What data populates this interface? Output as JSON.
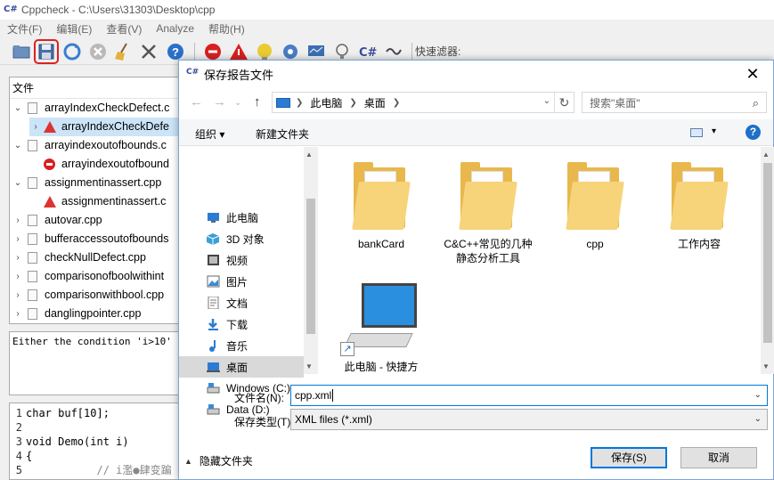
{
  "app": {
    "title": "Cppcheck - C:\\Users\\31303\\Desktop\\cpp",
    "menu": [
      "文件(F)",
      "编辑(E)",
      "查看(V)",
      "Analyze",
      "帮助(H)"
    ],
    "quick_filter_label": "快速滤器:"
  },
  "tree": {
    "header": "文件",
    "rows": [
      {
        "text": "arrayIndexCheckDefect.c",
        "level": 0,
        "expander": "v",
        "icon": "file-icon"
      },
      {
        "text": "arrayIndexCheckDefe",
        "level": 1,
        "expander": ">",
        "icon": "warning-icon",
        "selected": true
      },
      {
        "text": "arrayindexoutofbounds.c",
        "level": 0,
        "expander": "v",
        "icon": "file-icon"
      },
      {
        "text": "arrayindexoutofbound",
        "level": 1,
        "expander": "",
        "icon": "error-icon"
      },
      {
        "text": "assignmentinassert.cpp",
        "level": 0,
        "expander": "v",
        "icon": "file-icon"
      },
      {
        "text": "assignmentinassert.c",
        "level": 1,
        "expander": "",
        "icon": "warning-icon"
      },
      {
        "text": "autovar.cpp",
        "level": 0,
        "expander": ">",
        "icon": "file-icon"
      },
      {
        "text": "bufferaccessoutofbounds",
        "level": 0,
        "expander": ">",
        "icon": "file-icon"
      },
      {
        "text": "checkNullDefect.cpp",
        "level": 0,
        "expander": ">",
        "icon": "file-icon"
      },
      {
        "text": "comparisonofboolwithint",
        "level": 0,
        "expander": ">",
        "icon": "file-icon"
      },
      {
        "text": "comparisonwithbool.cpp",
        "level": 0,
        "expander": ">",
        "icon": "file-icon"
      },
      {
        "text": "danglingpointer.cpp",
        "level": 0,
        "expander": ">",
        "icon": "file-icon"
      }
    ]
  },
  "detail_text": "Either the condition 'i>10' is",
  "code": [
    {
      "n": "1",
      "text": "char buf[10];"
    },
    {
      "n": "2",
      "text": ""
    },
    {
      "n": "3",
      "text": "void Demo(int i)"
    },
    {
      "n": "4",
      "text": "{"
    },
    {
      "n": "5",
      "text": "           // i濫●肆变蹁"
    }
  ],
  "dialog": {
    "title": "保存报告文件",
    "close_glyph": "✕",
    "breadcrumb": [
      "此电脑",
      "桌面"
    ],
    "search_placeholder": "搜索\"桌面\"",
    "organize_label": "组织 ▾",
    "new_folder_label": "新建文件夹",
    "nav_items": [
      {
        "label": "此电脑",
        "icon": "computer-icon",
        "selected": false
      },
      {
        "label": "3D 对象",
        "icon": "cube-icon",
        "selected": false
      },
      {
        "label": "视频",
        "icon": "video-icon",
        "selected": false
      },
      {
        "label": "图片",
        "icon": "picture-icon",
        "selected": false
      },
      {
        "label": "文档",
        "icon": "document-icon",
        "selected": false
      },
      {
        "label": "下载",
        "icon": "download-icon",
        "selected": false
      },
      {
        "label": "音乐",
        "icon": "music-icon",
        "selected": false
      },
      {
        "label": "桌面",
        "icon": "desktop-icon",
        "selected": true
      },
      {
        "label": "Windows (C:)",
        "icon": "drive-icon",
        "selected": false
      },
      {
        "label": "Data (D:)",
        "icon": "drive-icon",
        "selected": false
      }
    ],
    "files": [
      {
        "name": "bankCard",
        "type": "folder"
      },
      {
        "name": "C&C++常见的几种静态分析工具",
        "type": "folder"
      },
      {
        "name": "cpp",
        "type": "folder"
      },
      {
        "name": "工作内容",
        "type": "folder"
      },
      {
        "name": "此电脑 - 快捷方",
        "type": "shortcut"
      }
    ],
    "filename_label": "文件名(N):",
    "filename_value": "cpp.xml",
    "filetype_label": "保存类型(T):",
    "filetype_value": "XML files (*.xml)",
    "hide_folders_label": "隐藏文件夹",
    "save_label": "保存(S)",
    "cancel_label": "取消",
    "colors": {
      "accent": "#0078d7",
      "selection": "#d9d9d9",
      "folder": "#e8b84c"
    }
  }
}
